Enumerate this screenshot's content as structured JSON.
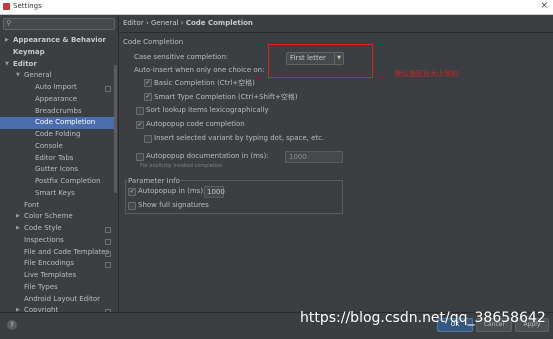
{
  "window": {
    "title": "Settings"
  },
  "sidebar": {
    "search_placeholder": "",
    "items": [
      {
        "label": "Appearance & Behavior",
        "indent": 0,
        "arrow": "right",
        "bold": true
      },
      {
        "label": "Keymap",
        "indent": 0,
        "bold": true
      },
      {
        "label": "Editor",
        "indent": 0,
        "arrow": "down",
        "bold": true
      },
      {
        "label": "General",
        "indent": 1,
        "arrow": "down"
      },
      {
        "label": "Auto Import",
        "indent": 2,
        "project": true
      },
      {
        "label": "Appearance",
        "indent": 2
      },
      {
        "label": "Breadcrumbs",
        "indent": 2
      },
      {
        "label": "Code Completion",
        "indent": 2,
        "selected": true
      },
      {
        "label": "Code Folding",
        "indent": 2
      },
      {
        "label": "Console",
        "indent": 2
      },
      {
        "label": "Editor Tabs",
        "indent": 2
      },
      {
        "label": "Gutter Icons",
        "indent": 2
      },
      {
        "label": "Postfix Completion",
        "indent": 2
      },
      {
        "label": "Smart Keys",
        "indent": 2
      },
      {
        "label": "Font",
        "indent": 1
      },
      {
        "label": "Color Scheme",
        "indent": 1,
        "arrow": "right"
      },
      {
        "label": "Code Style",
        "indent": 1,
        "arrow": "right",
        "project": true
      },
      {
        "label": "Inspections",
        "indent": 1,
        "project": true
      },
      {
        "label": "File and Code Templates",
        "indent": 1,
        "project": true
      },
      {
        "label": "File Encodings",
        "indent": 1,
        "project": true
      },
      {
        "label": "Live Templates",
        "indent": 1
      },
      {
        "label": "File Types",
        "indent": 1
      },
      {
        "label": "Android Layout Editor",
        "indent": 1
      },
      {
        "label": "Copyright",
        "indent": 1,
        "arrow": "right",
        "project": true
      }
    ]
  },
  "breadcrumb": {
    "part1": "Editor",
    "sep": " › ",
    "part2": "General",
    "part3": "Code Completion"
  },
  "code_completion": {
    "section_title": "Code Completion",
    "case_label": "Case sensitive completion:",
    "case_value": "First letter",
    "autoinsert_label": "Auto-insert when only one choice on:",
    "basic_completion": "Basic Completion (Ctrl+空格)",
    "smart_type_completion": "Smart Type Completion (Ctrl+Shift+空格)",
    "sort_lexicographically": "Sort lookup items lexicographically",
    "autopopup_completion": "Autopopup code completion",
    "insert_selected_variant": "Insert selected variant by typing dot, space, etc.",
    "autopopup_docs": "Autopopup documentation in (ms):",
    "autopopup_docs_value": "1000",
    "explicit_note": "For explicitly invoked completion"
  },
  "parameter_info": {
    "title": "Parameter Info",
    "autopopup_label": "Autopopup in (ms):",
    "autopopup_value": "1000",
    "show_full_signatures": "Show full signatures"
  },
  "annotation": {
    "text": "默认是区分大小写的"
  },
  "footer": {
    "help": "?",
    "ok": "OK",
    "cancel": "Cancel",
    "apply": "Apply"
  },
  "watermark": "https://blog.csdn.net/qq_38658642",
  "colors": {
    "selection": "#4b6eaf",
    "annotation_red": "#e02020",
    "background": "#3c3f41"
  }
}
